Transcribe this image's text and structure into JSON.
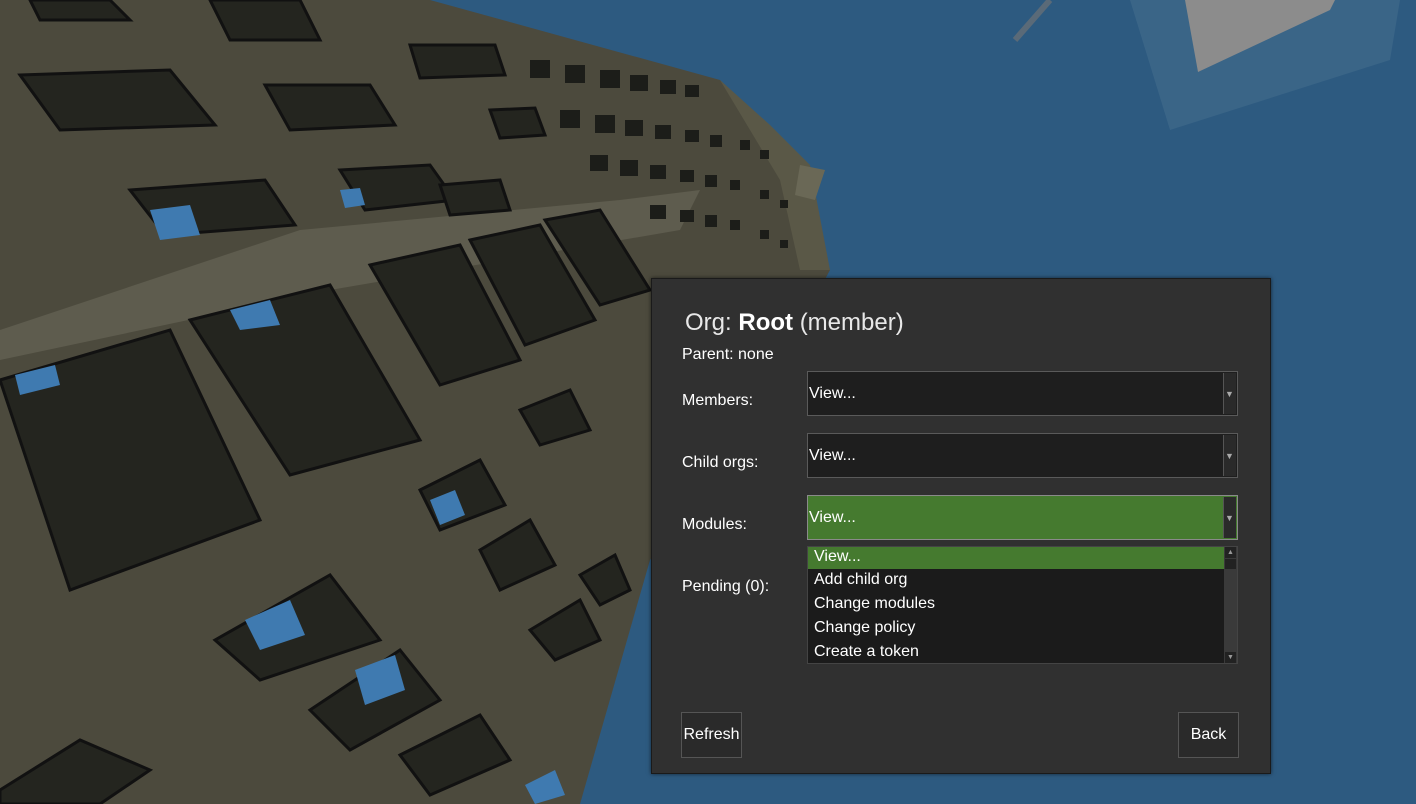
{
  "dialog": {
    "title_prefix": "Org:",
    "title_name": "Root",
    "title_suffix": "(member)",
    "parent": "Parent: none",
    "members_label": "Members:",
    "members_value": "View...",
    "child_orgs_label": "Child orgs:",
    "child_orgs_value": "View...",
    "modules_label": "Modules:",
    "modules_value": "View...",
    "pending_label": "Pending (0):",
    "modules_options": [
      "View...",
      "Add child org",
      "Change modules",
      "Change policy",
      "Create a token"
    ],
    "refresh_label": "Refresh",
    "back_label": "Back"
  },
  "colors": {
    "sky": "#2d5a80",
    "building": "#4a473a",
    "selection_green": "#457a2f",
    "dialog_bg": "#303030"
  }
}
